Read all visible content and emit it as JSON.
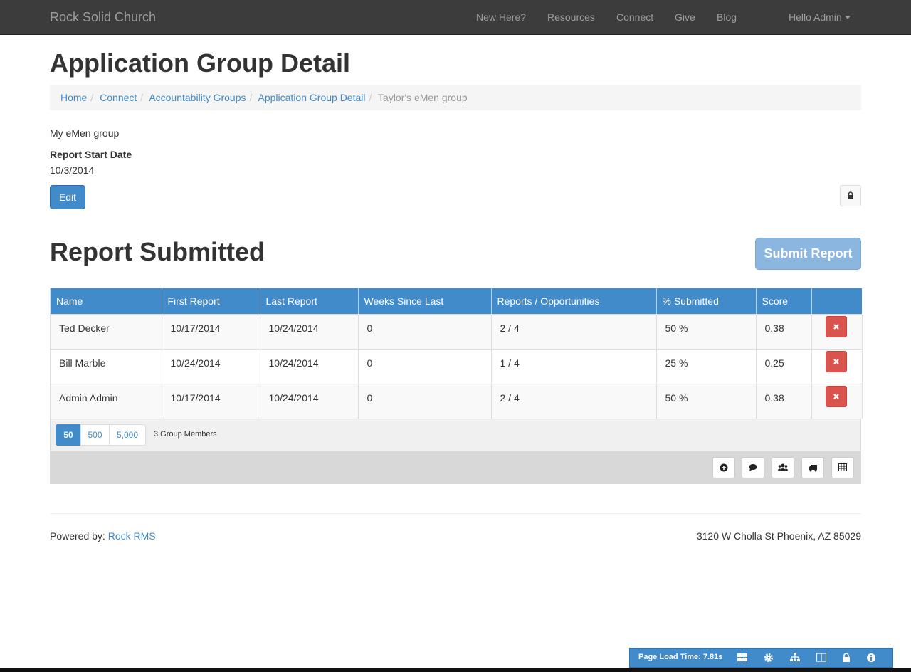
{
  "navbar": {
    "brand": "Rock Solid Church",
    "items": [
      "New Here?",
      "Resources",
      "Connect",
      "Give",
      "Blog"
    ],
    "user_menu": "Hello Admin"
  },
  "page": {
    "title": "Application Group Detail"
  },
  "breadcrumb": [
    "Home",
    "Connect",
    "Accountability Groups",
    "Application Group Detail",
    "Taylor's eMen group"
  ],
  "group": {
    "description": "My eMen group",
    "start_label": "Report Start Date",
    "start_value": "10/3/2014",
    "edit_label": "Edit"
  },
  "report": {
    "title": "Report Submitted",
    "submit_label": "Submit Report",
    "columns": [
      "Name",
      "First Report",
      "Last Report",
      "Weeks Since Last",
      "Reports / Opportunities",
      "% Submitted",
      "Score",
      ""
    ],
    "rows": [
      [
        "Ted Decker",
        "10/17/2014",
        "10/24/2014",
        "0",
        "2 / 4",
        "50 %",
        "0.38"
      ],
      [
        "Bill Marble",
        "10/24/2014",
        "10/24/2014",
        "0",
        "1 / 4",
        "25 %",
        "0.25"
      ],
      [
        "Admin Admin",
        "10/17/2014",
        "10/24/2014",
        "0",
        "2 / 4",
        "50 %",
        "0.38"
      ]
    ],
    "page_sizes": [
      "50",
      "500",
      "5,000"
    ],
    "active_page_size": "50",
    "member_count": "3 Group Members",
    "action_icons": [
      "add-icon",
      "comment-icon",
      "users-icon",
      "truck-icon",
      "table-icon"
    ]
  },
  "footer": {
    "powered_prefix": "Powered by:",
    "powered_link": "Rock RMS",
    "address": "3120 W Cholla St Phoenix, AZ 85029"
  },
  "admin_bar": {
    "load_time": "Page Load Time: 7.81s",
    "icons": [
      "blocks-icon",
      "gear-icon",
      "sitemap-icon",
      "columns-icon",
      "lock-icon",
      "info-icon"
    ]
  },
  "colors": {
    "primary": "#428bca",
    "danger": "#d9534f",
    "navbar": "#3c3c3c"
  }
}
